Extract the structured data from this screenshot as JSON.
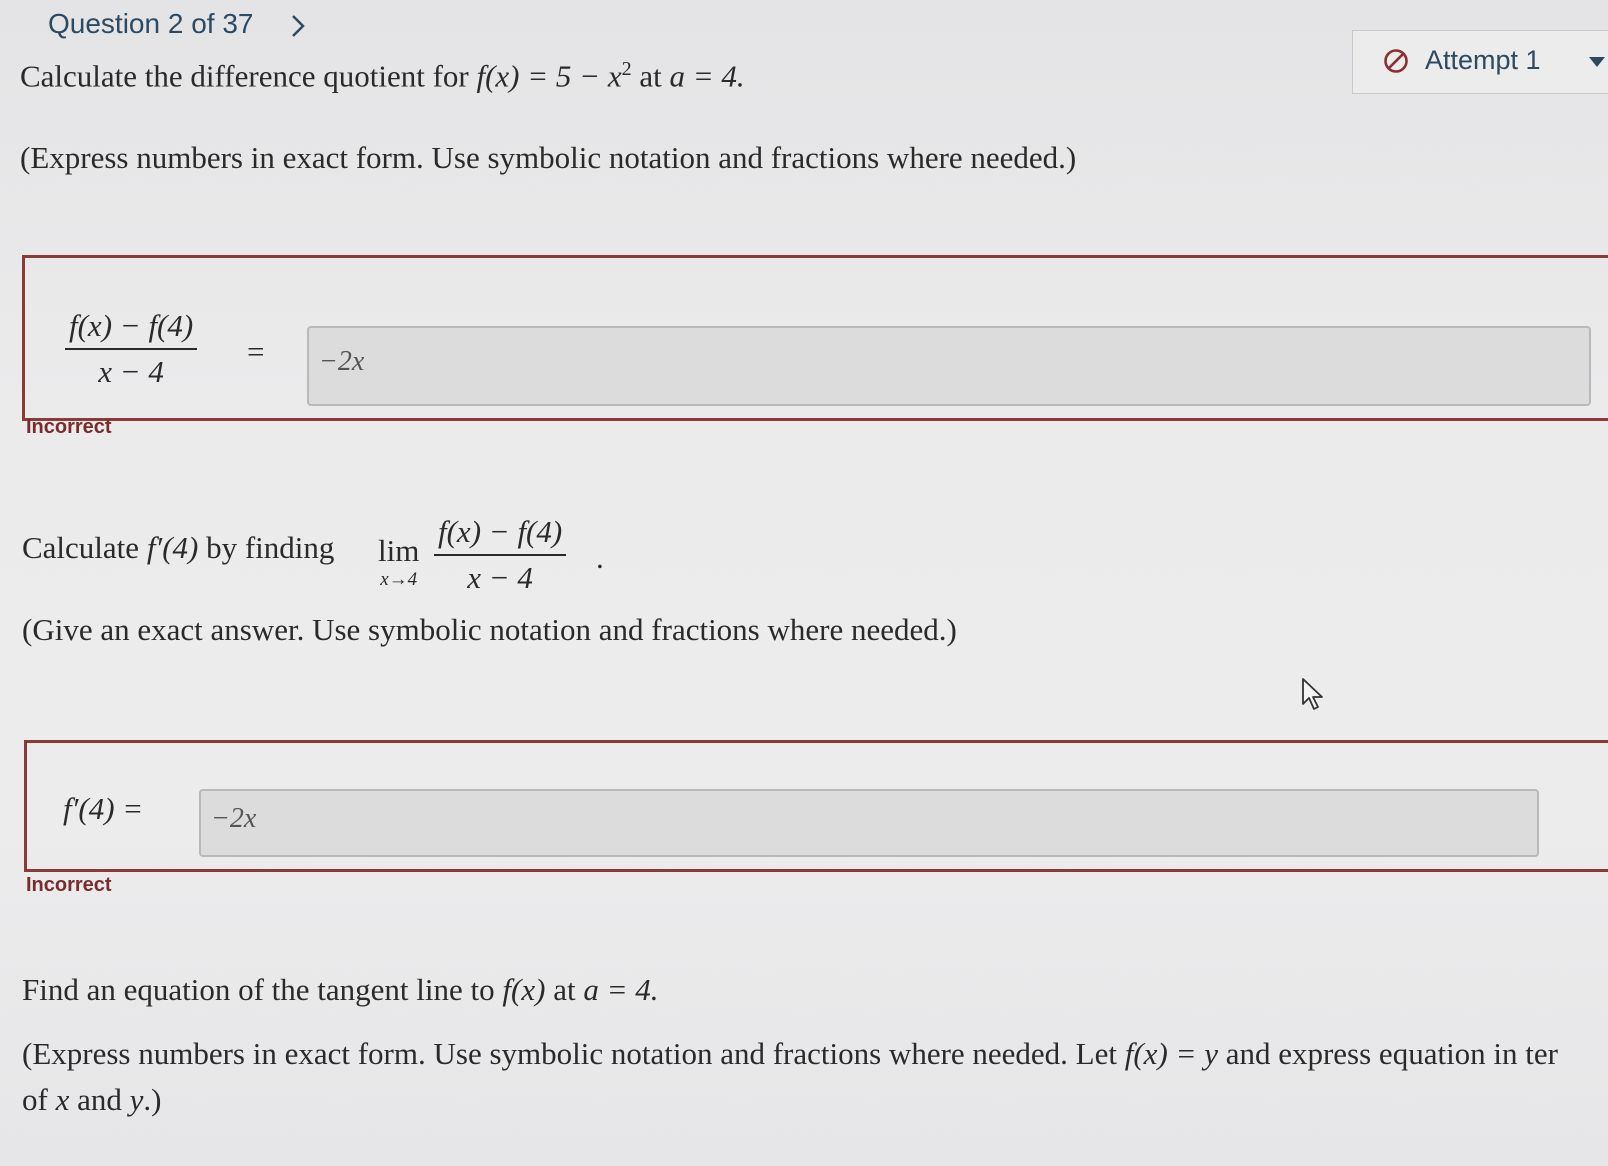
{
  "nav": {
    "question_label": "Question 2 of 37"
  },
  "attempt": {
    "label": "Attempt 1"
  },
  "q1": {
    "prompt_prefix": "Calculate the difference quotient for",
    "function_expr": "f(x) = 5 − x",
    "exponent": "2",
    "prompt_mid": "at",
    "point_expr": "a = 4.",
    "instruction": "(Express numbers in exact form. Use symbolic notation and fractions where needed.)",
    "lhs_numerator": "f(x) − f(4)",
    "lhs_denominator": "x − 4",
    "equals": "=",
    "answer_value": "−2x",
    "feedback": "Incorrect"
  },
  "q2": {
    "prompt_prefix": "Calculate",
    "derivative_expr": "f′(4)",
    "prompt_mid": "by finding",
    "lim_word": "lim",
    "lim_sub": "x→4",
    "numerator": "f(x) − f(4)",
    "denominator": "x − 4",
    "period": ".",
    "instruction": "(Give an exact answer. Use symbolic notation and fractions where needed.)",
    "lhs": "f′(4) =",
    "answer_value": "−2x",
    "feedback": "Incorrect"
  },
  "q3": {
    "prompt_prefix": "Find an equation of the tangent line to",
    "function_expr": "f(x)",
    "prompt_mid": "at",
    "point_expr": "a = 4.",
    "instruction_line1_a": "(Express numbers in exact form. Use symbolic notation and fractions where needed. Let",
    "instruction_eq": "f(x) = y",
    "instruction_line1_b": "and express equation in ter",
    "instruction_line2_a": "of",
    "instruction_x": "x",
    "instruction_and": "and",
    "instruction_y": "y",
    "instruction_line2_b": ".)"
  },
  "icons": {
    "next": "chevron-right-icon",
    "attempt": "prohibited-icon",
    "dropdown": "caret-down-icon",
    "cursor": "mouse-pointer-icon"
  },
  "colors": {
    "nav_text": "#2d4a63",
    "incorrect_border": "#8b3a3a",
    "incorrect_text": "#7a2c2c",
    "input_bg": "#dcdcdd"
  }
}
